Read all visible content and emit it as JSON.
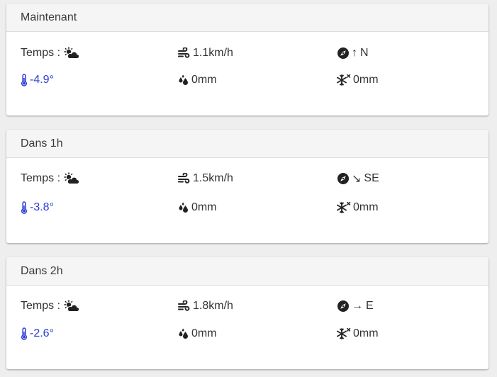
{
  "cards": [
    {
      "title": "Maintenant",
      "weather_label": "Temps :",
      "weather_icon": "sun-cloud-icon",
      "wind_speed": "1.1km/h",
      "wind_arrow": "↑",
      "wind_direction": "N",
      "temperature": "-4.9°",
      "rain": "0mm",
      "snow": "0mm"
    },
    {
      "title": "Dans 1h",
      "weather_label": "Temps :",
      "weather_icon": "sun-cloud-icon",
      "wind_speed": "1.5km/h",
      "wind_arrow": "↘",
      "wind_direction": "SE",
      "temperature": "-3.8°",
      "rain": "0mm",
      "snow": "0mm"
    },
    {
      "title": "Dans 2h",
      "weather_label": "Temps :",
      "weather_icon": "sun-cloud-icon",
      "wind_speed": "1.8km/h",
      "wind_arrow": "→",
      "wind_direction": "E",
      "temperature": "-2.6°",
      "rain": "0mm",
      "snow": "0mm"
    }
  ],
  "colors": {
    "temperature": "#2b3bd6",
    "text": "#333333",
    "header_bg": "#f5f5f5",
    "page_bg": "#eeeeee"
  }
}
